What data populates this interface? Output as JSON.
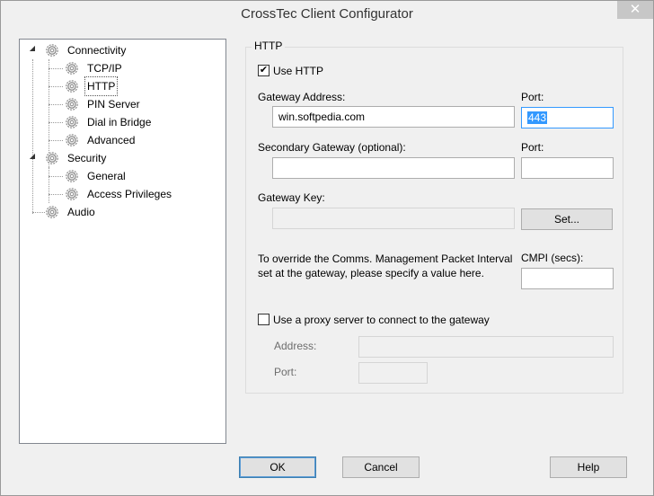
{
  "window": {
    "title": "CrossTec Client Configurator",
    "close_glyph": "✕"
  },
  "tree": {
    "items": [
      {
        "label": "Connectivity",
        "level": 0
      },
      {
        "label": "TCP/IP",
        "level": 1
      },
      {
        "label": "HTTP",
        "level": 1
      },
      {
        "label": "PIN Server",
        "level": 1
      },
      {
        "label": "Dial in Bridge",
        "level": 1
      },
      {
        "label": "Advanced",
        "level": 1
      },
      {
        "label": "Security",
        "level": 0
      },
      {
        "label": "General",
        "level": 1
      },
      {
        "label": "Access Privileges",
        "level": 1
      },
      {
        "label": "Audio",
        "level": 0
      }
    ],
    "expander_glyph": "◢"
  },
  "http": {
    "group_title": "HTTP",
    "use_http": {
      "label": "Use HTTP",
      "checked": true,
      "glyph": "✔"
    },
    "gateway_address": {
      "label": "Gateway Address:",
      "value": "win.softpedia.com"
    },
    "port": {
      "label": "Port:",
      "value": "443"
    },
    "secondary_gateway": {
      "label": "Secondary Gateway (optional):",
      "value": ""
    },
    "secondary_port": {
      "label": "Port:",
      "value": ""
    },
    "gateway_key": {
      "label": "Gateway Key:",
      "value": "",
      "set_button": "Set..."
    },
    "cmpi": {
      "description": "To override the Comms. Management Packet Interval set at the gateway, please specify a value here.",
      "label": "CMPI (secs):",
      "value": ""
    },
    "proxy": {
      "label": "Use a proxy server to connect to the gateway",
      "checked": false,
      "address_label": "Address:",
      "address_value": "",
      "port_label": "Port:",
      "port_value": ""
    }
  },
  "buttons": {
    "ok": "OK",
    "cancel": "Cancel",
    "help": "Help"
  }
}
